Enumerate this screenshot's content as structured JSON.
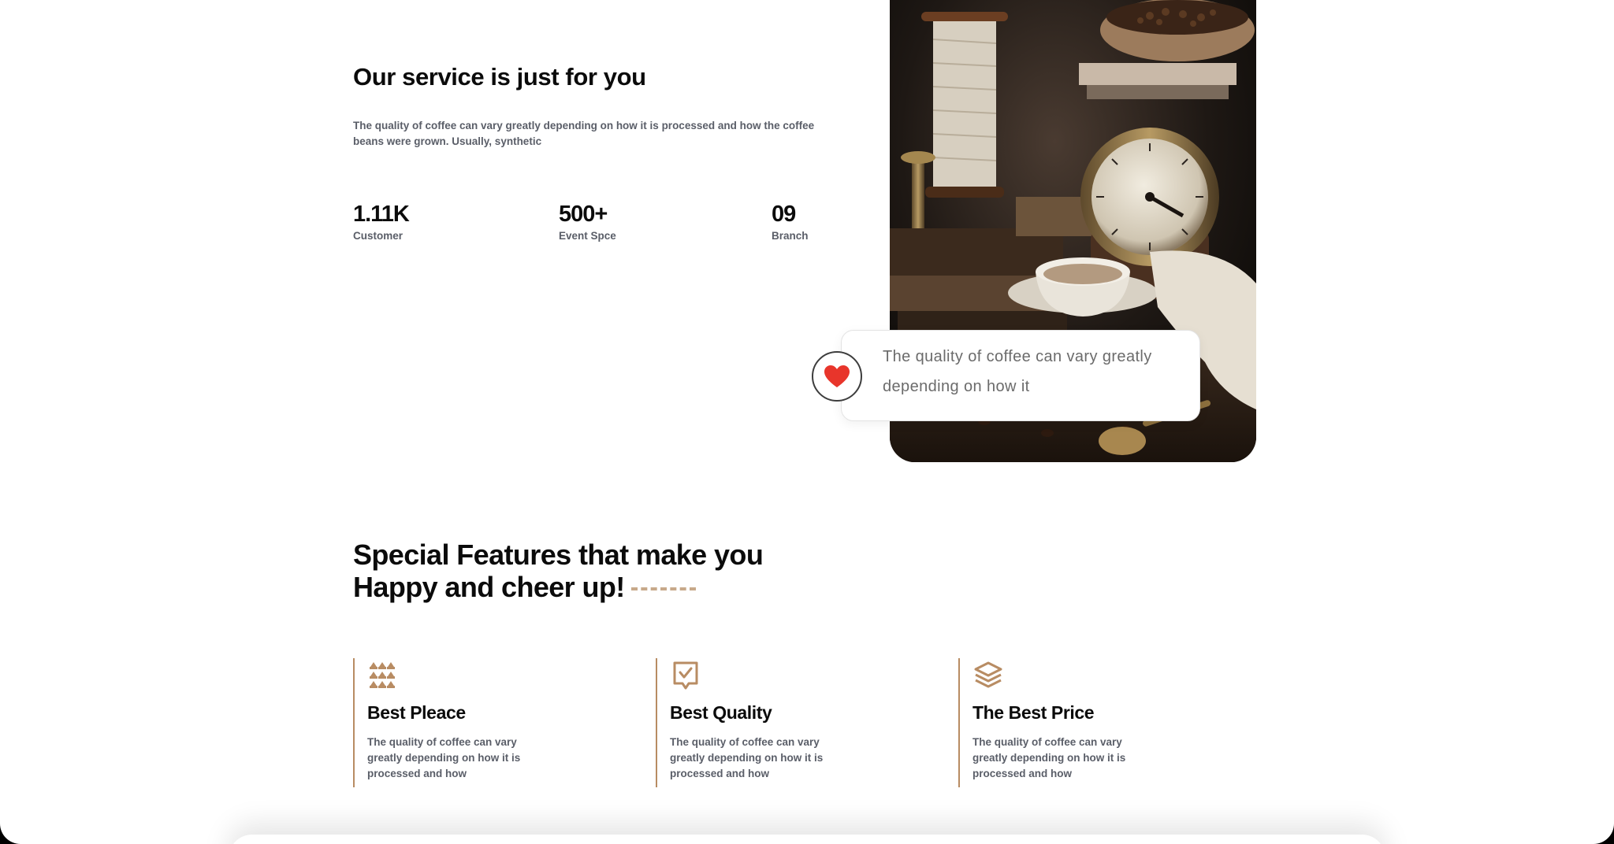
{
  "service": {
    "title": "Our service is just for you",
    "description": "The quality of coffee can vary greatly depending on how it is processed and how the coffee beans were grown. Usually, synthetic",
    "stats": [
      {
        "value": "1.11K",
        "label": "Customer"
      },
      {
        "value": "500+",
        "label": "Event Spce"
      },
      {
        "value": "09",
        "label": "Branch"
      }
    ]
  },
  "quote_card": {
    "text": "The quality of coffee can vary greatly depending on how it",
    "icon": "heart-icon"
  },
  "features": {
    "title_line1": "Special Features that make you",
    "title_line2": "Happy and cheer up!",
    "items": [
      {
        "icon": "coffee-beans-grid-icon",
        "name": "Best Pleace",
        "description": "The quality of coffee can vary greatly depending on how it is processed and how"
      },
      {
        "icon": "check-badge-icon",
        "name": "Best Quality",
        "description": "The quality of coffee can vary greatly depending on how it is processed and how"
      },
      {
        "icon": "layers-icon",
        "name": "The Best Price",
        "description": "The quality of coffee can vary greatly depending on how it is processed and how"
      }
    ]
  },
  "colors": {
    "accent": "#b88c63",
    "heart": "#e8352b",
    "text_dark": "#0b0b0b",
    "text_muted": "#5a5e68"
  }
}
